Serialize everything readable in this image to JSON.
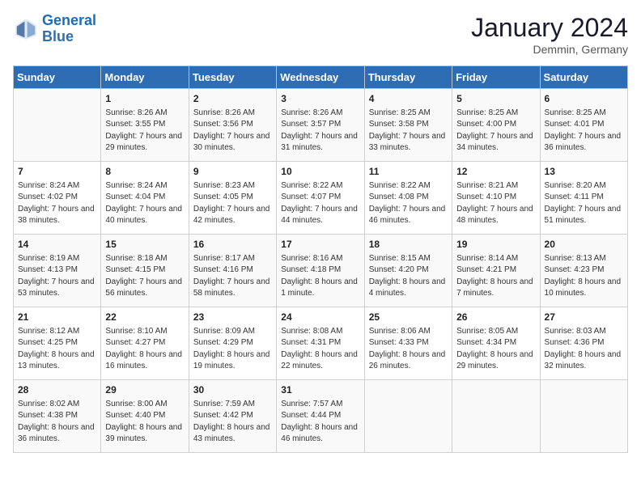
{
  "logo": {
    "line1": "General",
    "line2": "Blue"
  },
  "title": "January 2024",
  "location": "Demmin, Germany",
  "weekdays": [
    "Sunday",
    "Monday",
    "Tuesday",
    "Wednesday",
    "Thursday",
    "Friday",
    "Saturday"
  ],
  "weeks": [
    [
      {
        "day": "",
        "sunrise": "",
        "sunset": "",
        "daylight": ""
      },
      {
        "day": "1",
        "sunrise": "Sunrise: 8:26 AM",
        "sunset": "Sunset: 3:55 PM",
        "daylight": "Daylight: 7 hours and 29 minutes."
      },
      {
        "day": "2",
        "sunrise": "Sunrise: 8:26 AM",
        "sunset": "Sunset: 3:56 PM",
        "daylight": "Daylight: 7 hours and 30 minutes."
      },
      {
        "day": "3",
        "sunrise": "Sunrise: 8:26 AM",
        "sunset": "Sunset: 3:57 PM",
        "daylight": "Daylight: 7 hours and 31 minutes."
      },
      {
        "day": "4",
        "sunrise": "Sunrise: 8:25 AM",
        "sunset": "Sunset: 3:58 PM",
        "daylight": "Daylight: 7 hours and 33 minutes."
      },
      {
        "day": "5",
        "sunrise": "Sunrise: 8:25 AM",
        "sunset": "Sunset: 4:00 PM",
        "daylight": "Daylight: 7 hours and 34 minutes."
      },
      {
        "day": "6",
        "sunrise": "Sunrise: 8:25 AM",
        "sunset": "Sunset: 4:01 PM",
        "daylight": "Daylight: 7 hours and 36 minutes."
      }
    ],
    [
      {
        "day": "7",
        "sunrise": "Sunrise: 8:24 AM",
        "sunset": "Sunset: 4:02 PM",
        "daylight": "Daylight: 7 hours and 38 minutes."
      },
      {
        "day": "8",
        "sunrise": "Sunrise: 8:24 AM",
        "sunset": "Sunset: 4:04 PM",
        "daylight": "Daylight: 7 hours and 40 minutes."
      },
      {
        "day": "9",
        "sunrise": "Sunrise: 8:23 AM",
        "sunset": "Sunset: 4:05 PM",
        "daylight": "Daylight: 7 hours and 42 minutes."
      },
      {
        "day": "10",
        "sunrise": "Sunrise: 8:22 AM",
        "sunset": "Sunset: 4:07 PM",
        "daylight": "Daylight: 7 hours and 44 minutes."
      },
      {
        "day": "11",
        "sunrise": "Sunrise: 8:22 AM",
        "sunset": "Sunset: 4:08 PM",
        "daylight": "Daylight: 7 hours and 46 minutes."
      },
      {
        "day": "12",
        "sunrise": "Sunrise: 8:21 AM",
        "sunset": "Sunset: 4:10 PM",
        "daylight": "Daylight: 7 hours and 48 minutes."
      },
      {
        "day": "13",
        "sunrise": "Sunrise: 8:20 AM",
        "sunset": "Sunset: 4:11 PM",
        "daylight": "Daylight: 7 hours and 51 minutes."
      }
    ],
    [
      {
        "day": "14",
        "sunrise": "Sunrise: 8:19 AM",
        "sunset": "Sunset: 4:13 PM",
        "daylight": "Daylight: 7 hours and 53 minutes."
      },
      {
        "day": "15",
        "sunrise": "Sunrise: 8:18 AM",
        "sunset": "Sunset: 4:15 PM",
        "daylight": "Daylight: 7 hours and 56 minutes."
      },
      {
        "day": "16",
        "sunrise": "Sunrise: 8:17 AM",
        "sunset": "Sunset: 4:16 PM",
        "daylight": "Daylight: 7 hours and 58 minutes."
      },
      {
        "day": "17",
        "sunrise": "Sunrise: 8:16 AM",
        "sunset": "Sunset: 4:18 PM",
        "daylight": "Daylight: 8 hours and 1 minute."
      },
      {
        "day": "18",
        "sunrise": "Sunrise: 8:15 AM",
        "sunset": "Sunset: 4:20 PM",
        "daylight": "Daylight: 8 hours and 4 minutes."
      },
      {
        "day": "19",
        "sunrise": "Sunrise: 8:14 AM",
        "sunset": "Sunset: 4:21 PM",
        "daylight": "Daylight: 8 hours and 7 minutes."
      },
      {
        "day": "20",
        "sunrise": "Sunrise: 8:13 AM",
        "sunset": "Sunset: 4:23 PM",
        "daylight": "Daylight: 8 hours and 10 minutes."
      }
    ],
    [
      {
        "day": "21",
        "sunrise": "Sunrise: 8:12 AM",
        "sunset": "Sunset: 4:25 PM",
        "daylight": "Daylight: 8 hours and 13 minutes."
      },
      {
        "day": "22",
        "sunrise": "Sunrise: 8:10 AM",
        "sunset": "Sunset: 4:27 PM",
        "daylight": "Daylight: 8 hours and 16 minutes."
      },
      {
        "day": "23",
        "sunrise": "Sunrise: 8:09 AM",
        "sunset": "Sunset: 4:29 PM",
        "daylight": "Daylight: 8 hours and 19 minutes."
      },
      {
        "day": "24",
        "sunrise": "Sunrise: 8:08 AM",
        "sunset": "Sunset: 4:31 PM",
        "daylight": "Daylight: 8 hours and 22 minutes."
      },
      {
        "day": "25",
        "sunrise": "Sunrise: 8:06 AM",
        "sunset": "Sunset: 4:33 PM",
        "daylight": "Daylight: 8 hours and 26 minutes."
      },
      {
        "day": "26",
        "sunrise": "Sunrise: 8:05 AM",
        "sunset": "Sunset: 4:34 PM",
        "daylight": "Daylight: 8 hours and 29 minutes."
      },
      {
        "day": "27",
        "sunrise": "Sunrise: 8:03 AM",
        "sunset": "Sunset: 4:36 PM",
        "daylight": "Daylight: 8 hours and 32 minutes."
      }
    ],
    [
      {
        "day": "28",
        "sunrise": "Sunrise: 8:02 AM",
        "sunset": "Sunset: 4:38 PM",
        "daylight": "Daylight: 8 hours and 36 minutes."
      },
      {
        "day": "29",
        "sunrise": "Sunrise: 8:00 AM",
        "sunset": "Sunset: 4:40 PM",
        "daylight": "Daylight: 8 hours and 39 minutes."
      },
      {
        "day": "30",
        "sunrise": "Sunrise: 7:59 AM",
        "sunset": "Sunset: 4:42 PM",
        "daylight": "Daylight: 8 hours and 43 minutes."
      },
      {
        "day": "31",
        "sunrise": "Sunrise: 7:57 AM",
        "sunset": "Sunset: 4:44 PM",
        "daylight": "Daylight: 8 hours and 46 minutes."
      },
      {
        "day": "",
        "sunrise": "",
        "sunset": "",
        "daylight": ""
      },
      {
        "day": "",
        "sunrise": "",
        "sunset": "",
        "daylight": ""
      },
      {
        "day": "",
        "sunrise": "",
        "sunset": "",
        "daylight": ""
      }
    ]
  ]
}
